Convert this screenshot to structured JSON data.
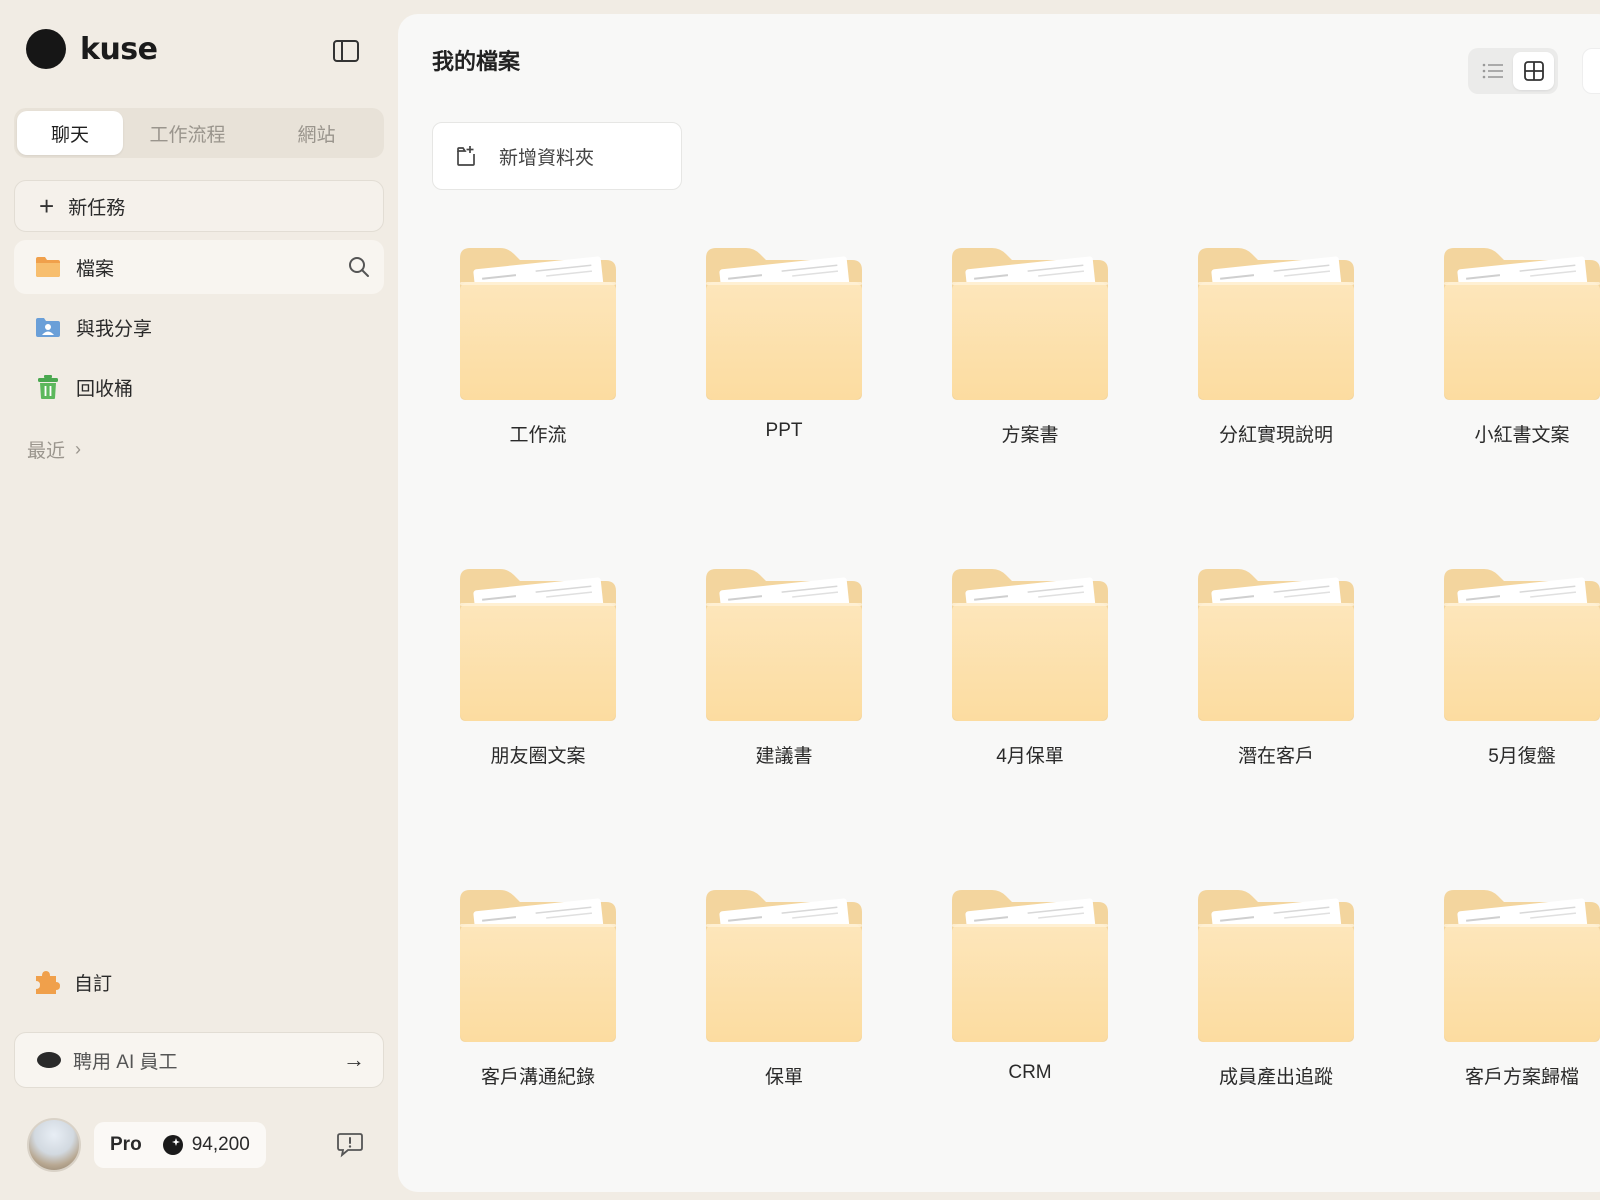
{
  "brand": {
    "name": "kuse"
  },
  "sidebar": {
    "tabs": [
      {
        "label": "聊天",
        "active": true
      },
      {
        "label": "工作流程",
        "active": false
      },
      {
        "label": "網站",
        "active": false
      }
    ],
    "new_task_label": "新任務",
    "nav": [
      {
        "label": "檔案",
        "icon": "folder-icon",
        "active": true
      },
      {
        "label": "與我分享",
        "icon": "shared-user-icon",
        "active": false
      },
      {
        "label": "回收桶",
        "icon": "trash-icon",
        "active": false
      }
    ],
    "recent_label": "最近",
    "custom_label": "自訂",
    "hire_label": "聘用 AI 員工",
    "plan_label": "Pro",
    "credits": "94,200"
  },
  "main": {
    "title": "我的檔案",
    "new_folder_label": "新增資料夾",
    "view_mode": "grid",
    "folders": [
      "工作流",
      "PPT",
      "方案書",
      "分紅實現說明",
      "小紅書文案",
      "朋友圈文案",
      "建議書",
      "4月保單",
      "潛在客戶",
      "5月復盤",
      "客戶溝通紀錄",
      "保單",
      "CRM",
      "成員產出追蹤",
      "客戶方案歸檔"
    ]
  },
  "colors": {
    "sidebar_bg": "#f1ece4",
    "main_bg": "#f8f8f7",
    "folder_back": "#f3d59e",
    "folder_front": "#fde7bd",
    "accent_green": "#5cb85c",
    "accent_blue": "#6a9fd8",
    "accent_orange": "#f0a04b"
  }
}
